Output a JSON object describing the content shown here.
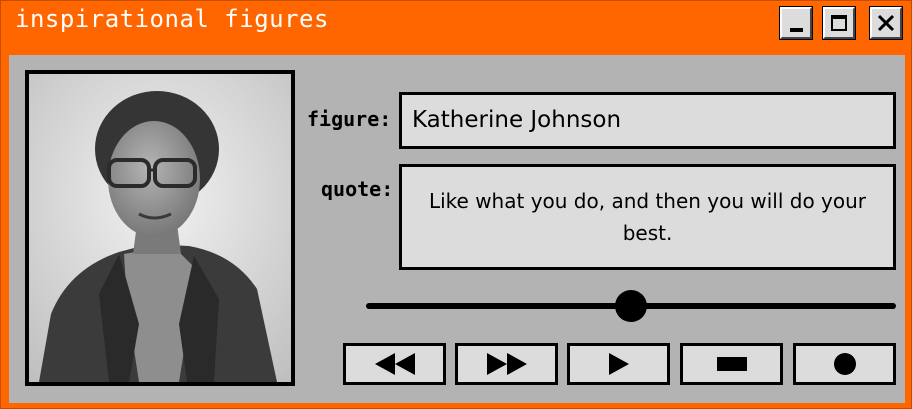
{
  "window": {
    "title": "inspirational figures"
  },
  "titlebar_buttons": {
    "minimize_icon": "minimize-icon",
    "maximize_icon": "maximize-icon",
    "close_icon": "close-icon"
  },
  "form": {
    "figure_label": "figure:",
    "figure_value": "Katherine Johnson",
    "quote_label": "quote:",
    "quote_value": "Like what you do, and then you will do your best."
  },
  "player": {
    "progress": 0.5,
    "controls": [
      "rewind-icon",
      "fast-forward-icon",
      "play-icon",
      "stop-icon",
      "record-icon"
    ]
  },
  "colors": {
    "frame": "#ff6600",
    "panel": "#b3b3b3",
    "field": "#dcdcdc"
  }
}
